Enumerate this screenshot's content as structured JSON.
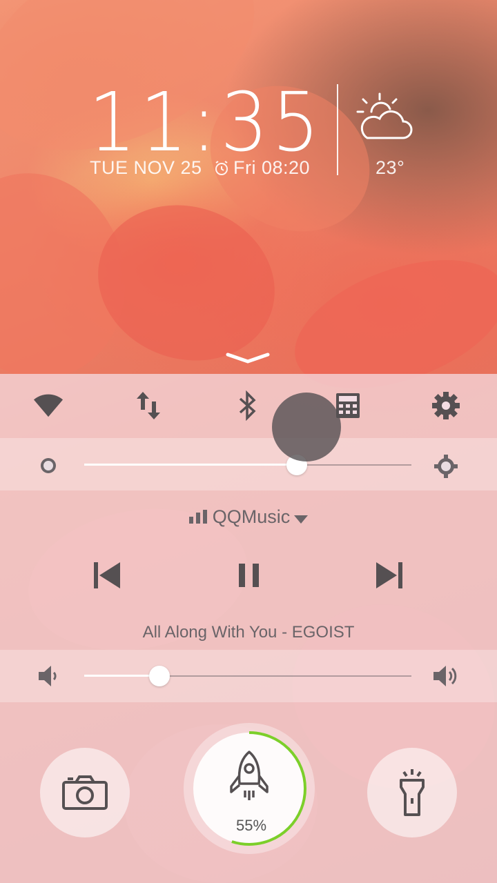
{
  "lockscreen": {
    "time": "11:35",
    "date": "TUE NOV 25",
    "alarm_icon": "alarm-clock-icon",
    "alarm": "Fri  08:20",
    "weather_icon": "partly-cloudy-icon",
    "temperature": "23°"
  },
  "quick_settings": {
    "toggles": [
      {
        "name": "wifi",
        "icon": "wifi-icon"
      },
      {
        "name": "mobile-data",
        "icon": "data-arrows-icon"
      },
      {
        "name": "bluetooth",
        "icon": "bluetooth-icon"
      },
      {
        "name": "calculator",
        "icon": "calculator-icon"
      },
      {
        "name": "settings",
        "icon": "gear-icon"
      }
    ],
    "brightness": {
      "level": 0.65,
      "low_icon": "brightness-low-icon",
      "high_icon": "brightness-high-icon"
    }
  },
  "music": {
    "app_name": "QQMusic",
    "song": "All Along With You - EGOIST",
    "controls": [
      "previous-icon",
      "pause-icon",
      "next-icon"
    ]
  },
  "volume": {
    "level": 0.23,
    "low_icon": "volume-low-icon",
    "high_icon": "volume-high-icon"
  },
  "shortcuts": {
    "camera_icon": "camera-icon",
    "boost_icon": "rocket-icon",
    "boost_percent": "55%",
    "boost_level": 0.55,
    "flashlight_icon": "flashlight-icon"
  },
  "colors": {
    "accent_ring": "#7ccf2a",
    "icon": "#555052"
  }
}
